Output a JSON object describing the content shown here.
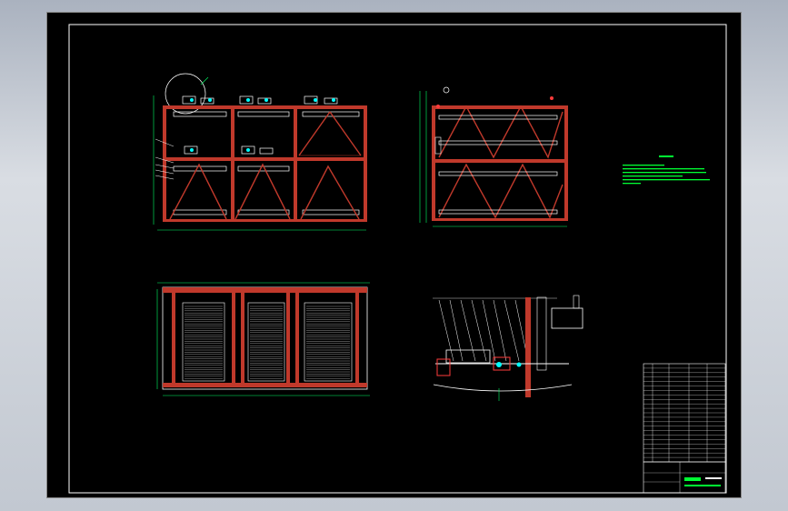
{
  "viewport": {
    "background": "#000000",
    "frame_color": "#ffffff"
  },
  "colors": {
    "frame": "#c0392b",
    "dim": "#00ff66",
    "line": "#ffffff",
    "accent": "#00ffff",
    "hatch": "#e8e8e8",
    "notes": "#00ff33",
    "detail": "#ff3b3b"
  },
  "views": [
    {
      "id": "front-elevation"
    },
    {
      "id": "side-elevation"
    },
    {
      "id": "plan-view"
    },
    {
      "id": "drive-detail"
    }
  ],
  "tech_notes": {
    "line_count": 6
  },
  "parts_list": {
    "row_count": 22
  },
  "title_block": {
    "label": "",
    "text_lines": 3
  }
}
